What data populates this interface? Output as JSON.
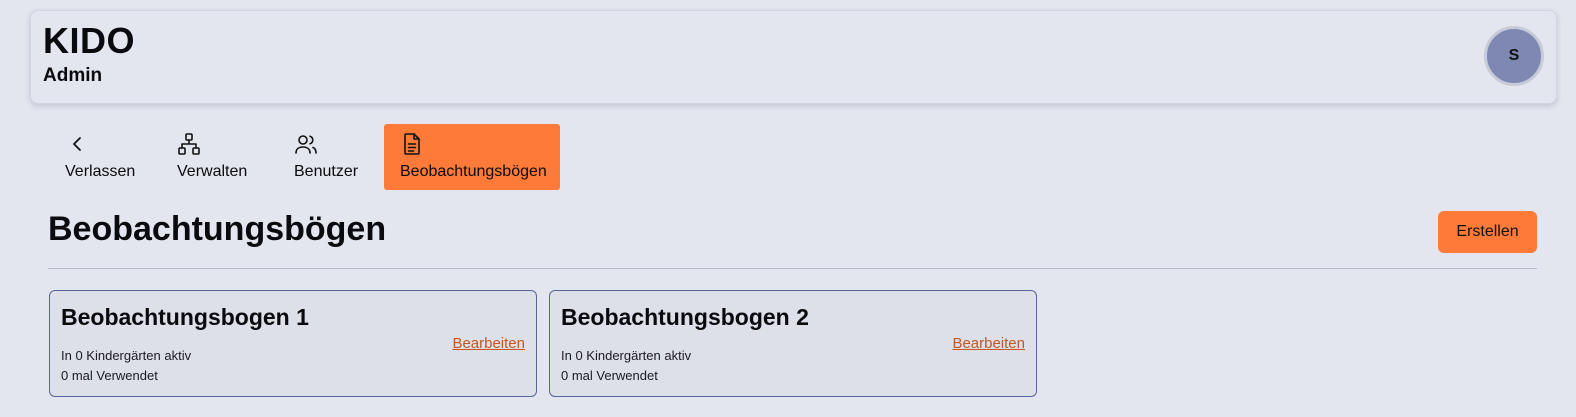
{
  "header": {
    "title": "KIDO",
    "subtitle": "Admin",
    "avatar_initial": "S"
  },
  "nav": {
    "items": [
      {
        "label": "Verlassen",
        "icon": "chevron-left-icon"
      },
      {
        "label": "Verwalten",
        "icon": "sitemap-icon"
      },
      {
        "label": "Benutzer",
        "icon": "users-icon"
      },
      {
        "label": "Beobachtungsbögen",
        "icon": "document-icon",
        "active": true
      }
    ]
  },
  "page": {
    "title": "Beobachtungsbögen",
    "create_label": "Erstellen"
  },
  "cards": [
    {
      "title": "Beobachtungsbogen 1",
      "active_text": "In 0 Kindergärten aktiv",
      "usage_text": "0 mal Verwendet",
      "edit_label": "Bearbeiten"
    },
    {
      "title": "Beobachtungsbogen 2",
      "active_text": "In 0 Kindergärten aktiv",
      "usage_text": "0 mal Verwendet",
      "edit_label": "Bearbeiten"
    }
  ],
  "colors": {
    "accent": "#fd7a38",
    "background": "#e3e6ee",
    "link": "#c2581f",
    "card_border": "#5a6499",
    "avatar": "#7e88b2"
  }
}
